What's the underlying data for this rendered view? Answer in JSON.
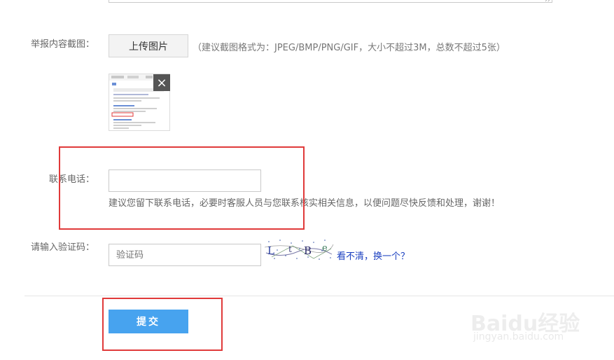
{
  "form": {
    "screenshot_label": "举报内容截图：",
    "upload_button": "上传图片",
    "upload_hint": "（建议截图格式为：JPEG/BMP/PNG/GIF，大小不超过3M，总数不超过5张）",
    "thumb_close": "×",
    "phone_label": "联系电话：",
    "phone_value": "",
    "phone_hint": "建议您留下联系电话，必要时客服人员与您联系核实相关信息，以便问题尽快反馈和处理，谢谢！",
    "captcha_label": "请输入验证码：",
    "captcha_placeholder": "验证码",
    "captcha_refresh": "看不清，换一个？",
    "submit_button": "提交"
  },
  "annotations": {
    "highlight_color": "#e03a3a"
  },
  "watermark": {
    "logo": "Baidu经验",
    "url": "jingyan.baidu.com"
  }
}
